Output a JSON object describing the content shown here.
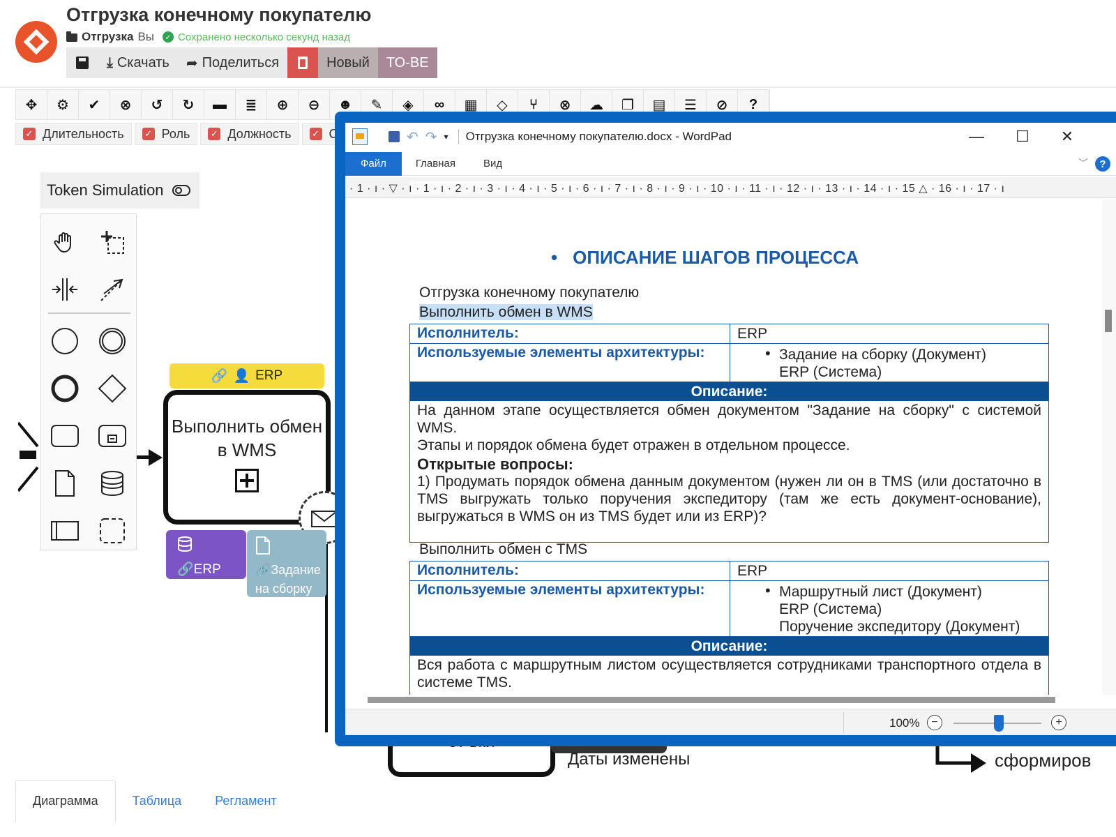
{
  "app": {
    "title": "Отгрузка конечному покупателю",
    "folder": "Отгрузка",
    "owner": "Вы",
    "save_status": "Сохранено несколько секунд назад",
    "actions": {
      "download": "Скачать",
      "share": "Поделиться",
      "status_new": "Новый",
      "status_tobe": "TO-BE"
    },
    "colors": {
      "accent": "#e8532a",
      "delete": "#d9534f",
      "erp_lane": "#f5dc3c",
      "data_store": "#7c54c4",
      "data_object": "#93b9c9"
    }
  },
  "toolbar": {
    "icons": [
      "move-icon",
      "settings-icon",
      "check-icon",
      "close-circle-icon",
      "undo-icon",
      "redo-icon",
      "ruler-icon",
      "align-icon",
      "zoom-in-icon",
      "zoom-out-icon",
      "users-icon",
      "edit-icon",
      "layers-icon",
      "link-icon",
      "map-icon",
      "paint-icon",
      "branch-icon",
      "stop-icon",
      "comments-icon",
      "copy-icon",
      "clipboard-icon",
      "list-icon",
      "ban-icon",
      "help-icon"
    ],
    "filters": [
      "Длительность",
      "Роль",
      "Должность",
      "Си"
    ]
  },
  "token_simulation": {
    "label": "Token Simulation"
  },
  "diagram": {
    "lane_label": "ERP",
    "task_label": "Выполнить обмен в WMS",
    "data_store_label": "ERP",
    "data_object_label": "Задание на сборку",
    "bottom_task_label": "от  вки",
    "dates_text": "Даты изменены",
    "right_text": "сформиров"
  },
  "tabs": [
    "Диаграмма",
    "Таблица",
    "Регламент"
  ],
  "wordpad": {
    "title": "Отгрузка конечному покупателю.docx - WordPad",
    "menu": [
      "Файл",
      "Главная",
      "Вид"
    ],
    "help": "?",
    "ruler": "· 1 · ı · ▽ · ı · 1 · ı · 2 · ı · 3 · ı · 4 · ı · 5 · ı · 6 · ı · 7 · ı · 8 · ı · 9 · ı · 10 · ı · 11 · ı · 12 · ı · 13 · ı · 14 · ı · 15 △ · 16 · ı · 17 · ı",
    "zoom": "100%",
    "document": {
      "heading": "ОПИСАНИЕ ШАГОВ ПРОЦЕССА",
      "process_title": "Отгрузка конечному покупателю",
      "steps": [
        {
          "title": "Выполнить обмен в WMS",
          "executor_label": "Исполнитель:",
          "executor": "ERP",
          "elements_label": "Используемые элементы архитектуры:",
          "elements": [
            "Задание на сборку (Документ)",
            "ERP (Система)"
          ],
          "description_label": "Описание:",
          "description": [
            "На данном этапе осуществляется обмен документом \"Задание на сборку\" с системой WMS.",
            "Этапы и порядок обмена будет отражен в отдельном процессе."
          ],
          "open_questions_label": "Открытые вопросы:",
          "open_questions": "1) Продумать порядок обмена данным документом (нужен ли он в TMS (или достаточно в TMS выгружать только поручения экспедитору (там же есть документ-основание), выгружаться в WMS он из TMS будет или из ERP)?"
        },
        {
          "title": "Выполнить обмен с TMS",
          "executor_label": "Исполнитель:",
          "executor": "ERP",
          "elements_label": "Используемые элементы архитектуры:",
          "elements": [
            "Маршрутный лист (Документ)",
            "ERP (Система)",
            "Поручение экспедитору (Документ)"
          ],
          "description_label": "Описание:",
          "description": [
            "Вся работа с маршрутным листом осуществляется сотрудниками транспортного отдела в системе TMS."
          ]
        }
      ]
    }
  }
}
